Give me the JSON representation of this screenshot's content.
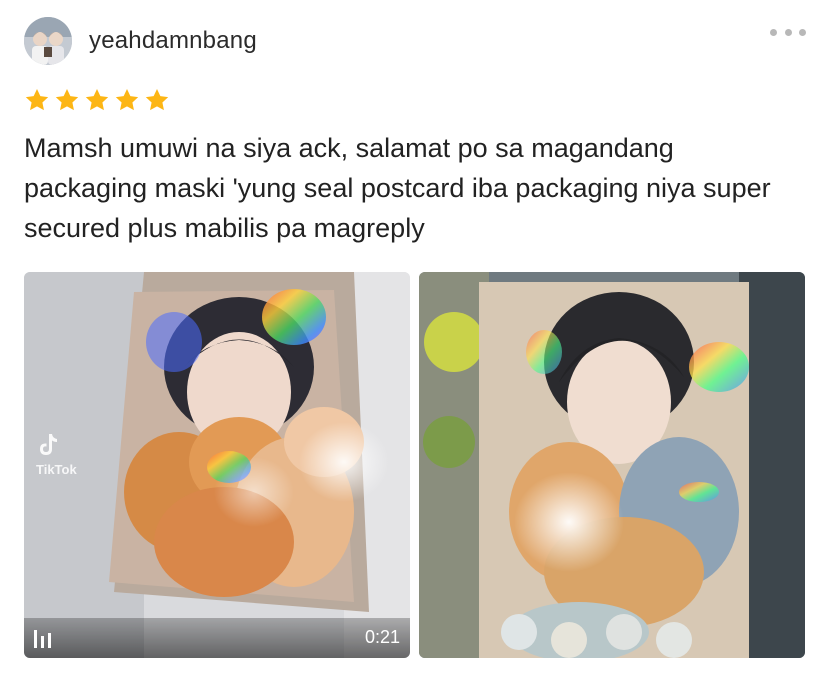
{
  "review": {
    "username": "yeahdamnbang",
    "rating": 5,
    "text": "Mamsh umuwi na siya ack, salamat po sa magandang packaging maski 'yung seal postcard iba packaging niya super secured plus mabilis pa magreply",
    "star_color": "#FDB614"
  },
  "media": {
    "video": {
      "duration": "0:21",
      "watermark": "TikTok",
      "icon": "video-bars-icon"
    },
    "photo": {
      "icon": "photo"
    }
  },
  "header": {
    "more_icon": "more-dots-icon"
  }
}
